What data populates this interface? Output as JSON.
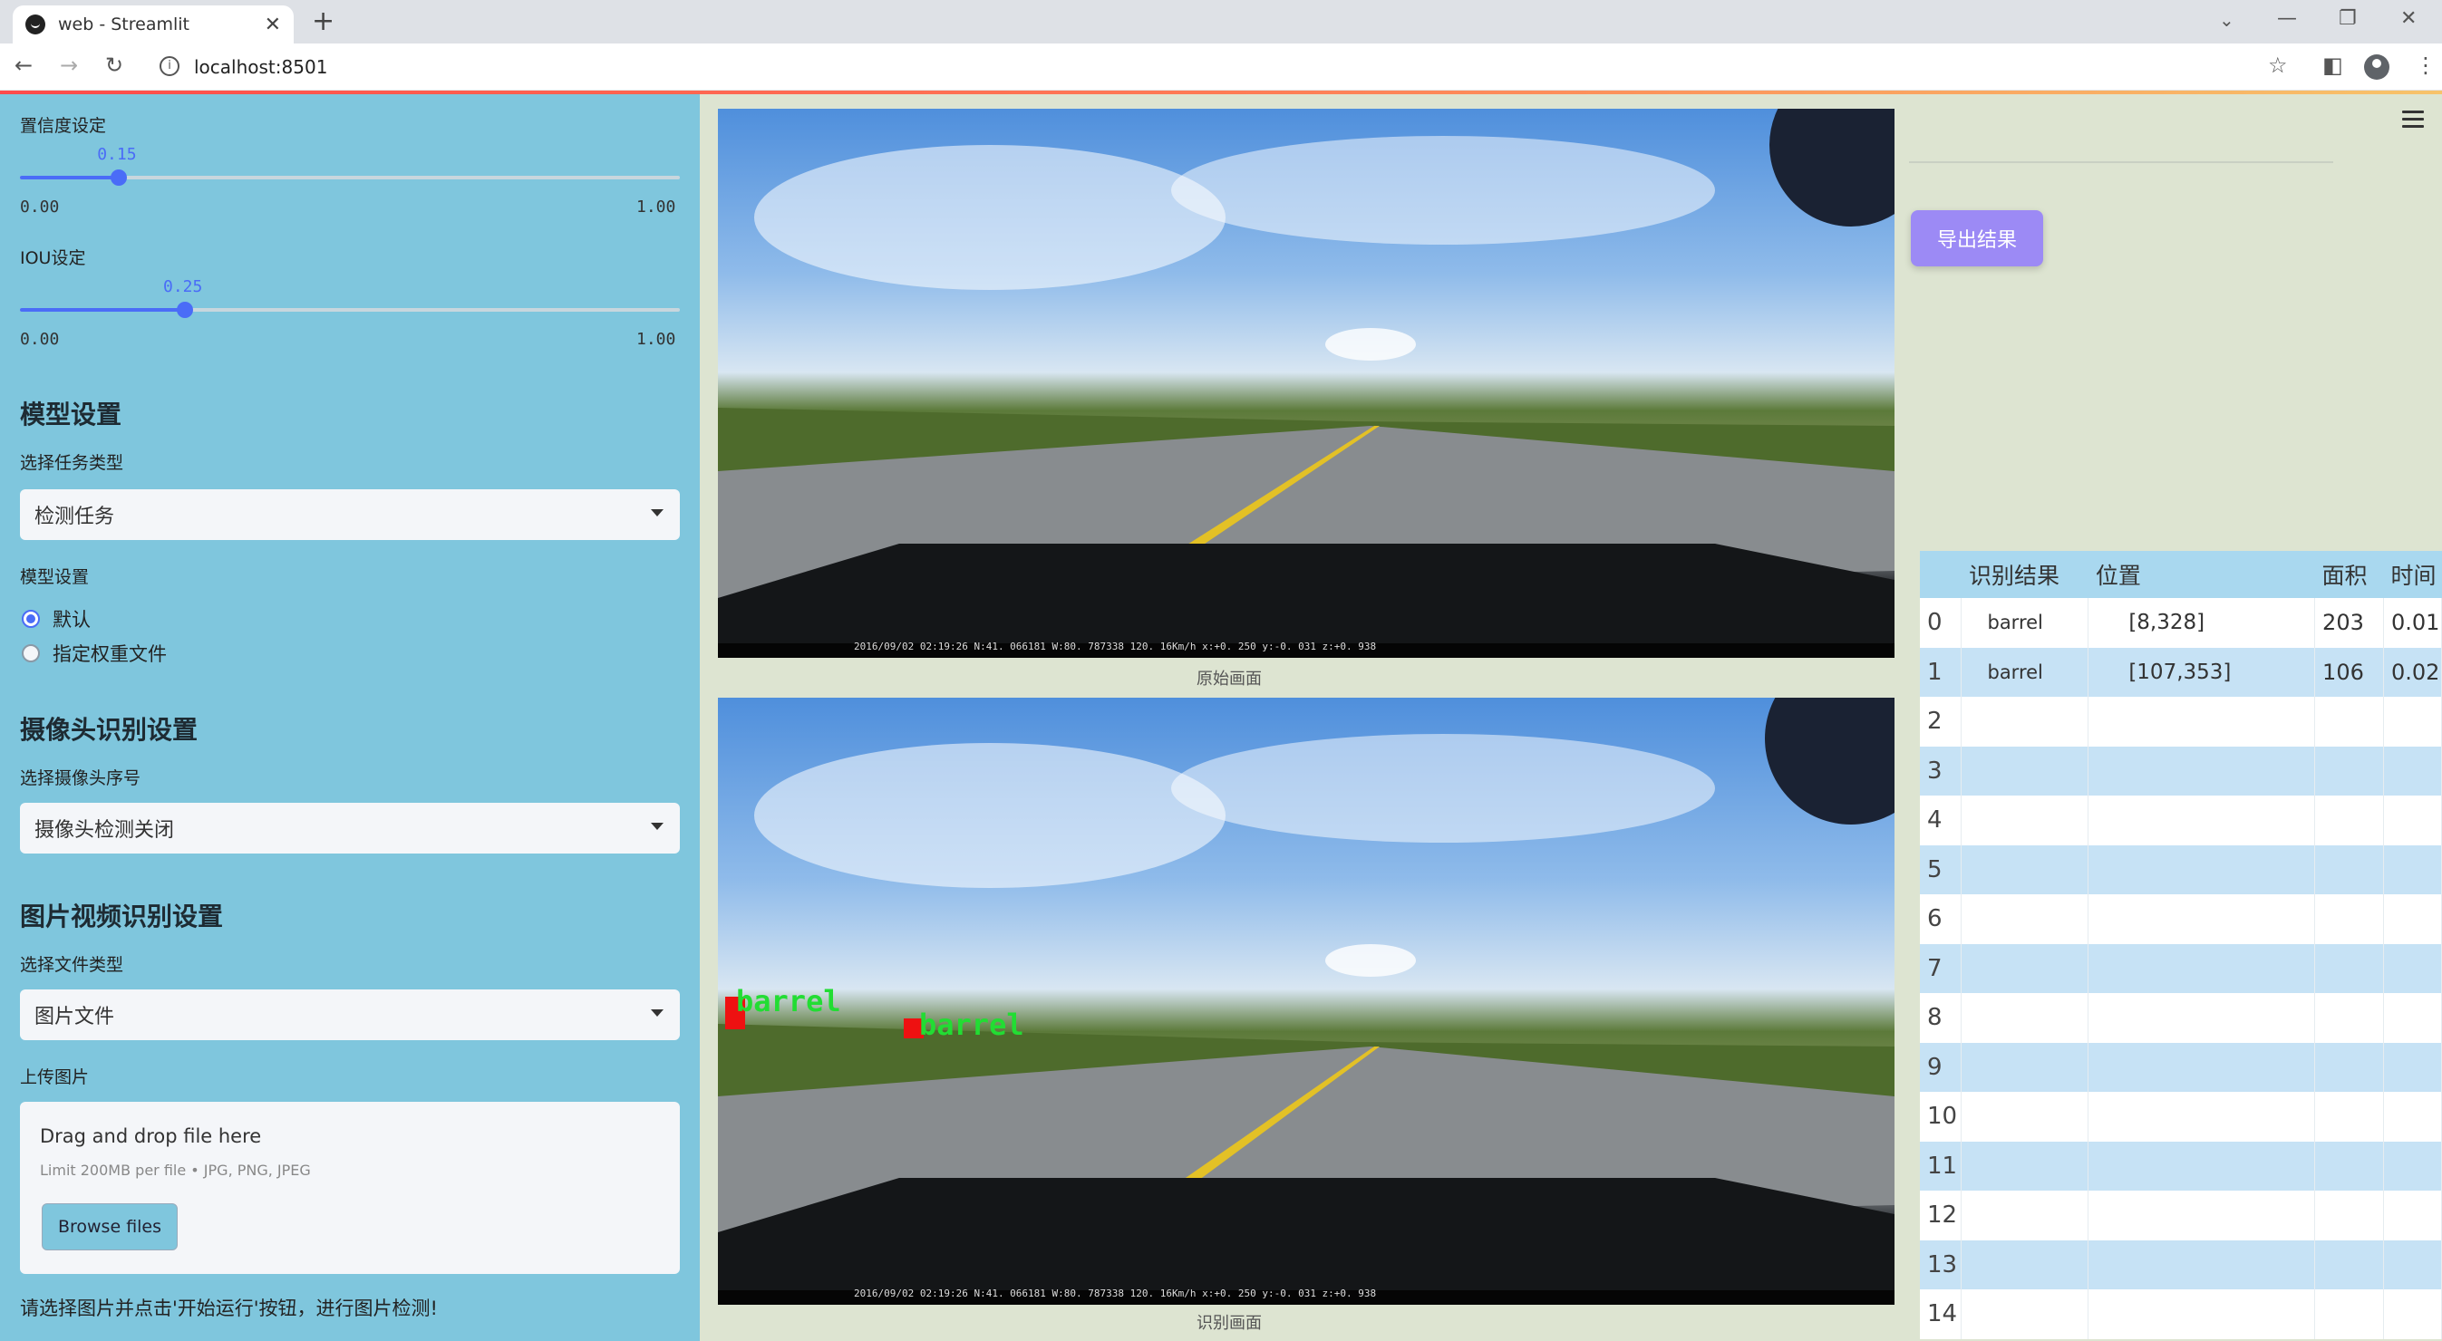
{
  "browser": {
    "tab_title": "web - Streamlit",
    "url": "localhost:8501"
  },
  "sidebar": {
    "confidence": {
      "label": "置信度设定",
      "value": "0.15",
      "min": "0.00",
      "max": "1.00",
      "fraction": 0.15
    },
    "iou": {
      "label": "IOU设定",
      "value": "0.25",
      "min": "0.00",
      "max": "1.00",
      "fraction": 0.25
    },
    "model_section": {
      "heading": "模型设置",
      "task_label": "选择任务类型",
      "task_value": "检测任务",
      "model_label": "模型设置",
      "options": [
        "默认",
        "指定权重文件"
      ],
      "selected": 0
    },
    "camera_section": {
      "heading": "摄像头识别设置",
      "camera_label": "选择摄像头序号",
      "camera_value": "摄像头检测关闭"
    },
    "media_section": {
      "heading": "图片视频识别设置",
      "file_type_label": "选择文件类型",
      "file_type_value": "图片文件",
      "upload_label": "上传图片",
      "drop_title": "Drag and drop file here",
      "drop_limit": "Limit 200MB per file • JPG, PNG, JPEG",
      "browse_label": "Browse files"
    },
    "hint": "请选择图片并点击'开始运行'按钮，进行图片检测!"
  },
  "images": {
    "original_caption": "原始画面",
    "detected_caption": "识别画面",
    "overlay_text": "2016/09/02   02:19:26 N:41. 066181   W:80. 787338     120. 16Km/h x:+0. 250 y:-0. 031 z:+0. 938",
    "detections": [
      {
        "label": "barrel"
      },
      {
        "label": "barrel"
      }
    ]
  },
  "right_panel": {
    "export_label": "导出结果",
    "table": {
      "headers": [
        "",
        "识别结果",
        "位置",
        "面积",
        "时间"
      ],
      "rows": [
        [
          "0",
          "barrel",
          "[8,328]",
          "203",
          "0.01"
        ],
        [
          "1",
          "barrel",
          "[107,353]",
          "106",
          "0.02"
        ],
        [
          "2",
          "",
          "",
          "",
          ""
        ],
        [
          "3",
          "",
          "",
          "",
          ""
        ],
        [
          "4",
          "",
          "",
          "",
          ""
        ],
        [
          "5",
          "",
          "",
          "",
          ""
        ],
        [
          "6",
          "",
          "",
          "",
          ""
        ],
        [
          "7",
          "",
          "",
          "",
          ""
        ],
        [
          "8",
          "",
          "",
          "",
          ""
        ],
        [
          "9",
          "",
          "",
          "",
          ""
        ],
        [
          "10",
          "",
          "",
          "",
          ""
        ],
        [
          "11",
          "",
          "",
          "",
          ""
        ],
        [
          "12",
          "",
          "",
          "",
          ""
        ],
        [
          "13",
          "",
          "",
          "",
          ""
        ],
        [
          "14",
          "",
          "",
          "",
          ""
        ]
      ]
    }
  },
  "colors": {
    "sidebar_bg": "#7fc6dd",
    "accent": "#4a6cf7",
    "export_button": "#9c8af5",
    "detection_text": "#22dd33",
    "detection_box": "#ee1111"
  }
}
